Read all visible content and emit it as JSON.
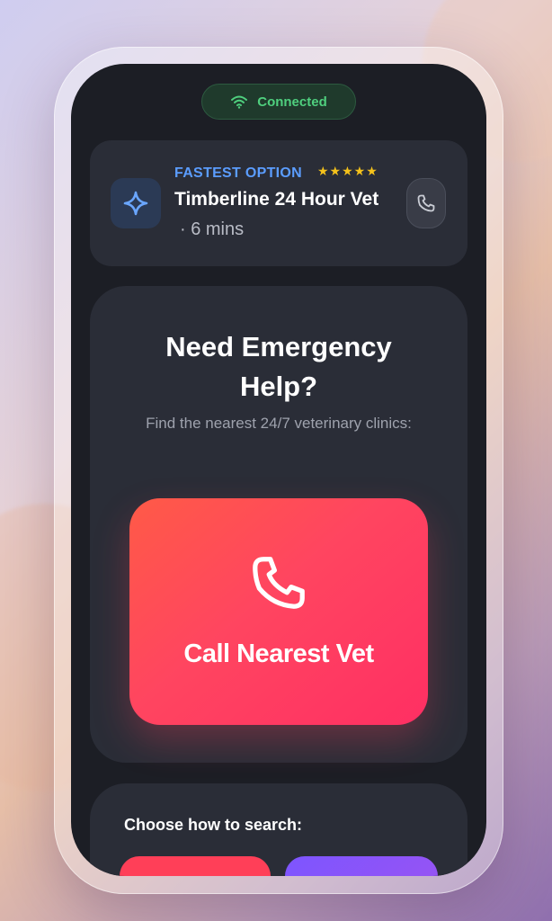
{
  "status": {
    "label": "Connected",
    "icon": "wifi-icon"
  },
  "fastest": {
    "tag": "FASTEST OPTION",
    "rating": "★★★★★",
    "name": "Timberline 24 Hour Vet",
    "time": "· 6 mins",
    "icon": "sparkle-icon",
    "call_icon": "phone-icon"
  },
  "emergency": {
    "title": "Need Emergency Help?",
    "subtitle": "Find the nearest 24/7 veterinary clinics:",
    "call_label": "Call Nearest Vet",
    "call_icon": "phone-icon"
  },
  "search": {
    "label": "Choose how to search:"
  },
  "colors": {
    "accent_blue": "#5b9dff",
    "connected_green": "#4fcf7e",
    "call_red": "#ff4560",
    "option_purple": "#7d55ff",
    "star_gold": "#f5c21b"
  }
}
